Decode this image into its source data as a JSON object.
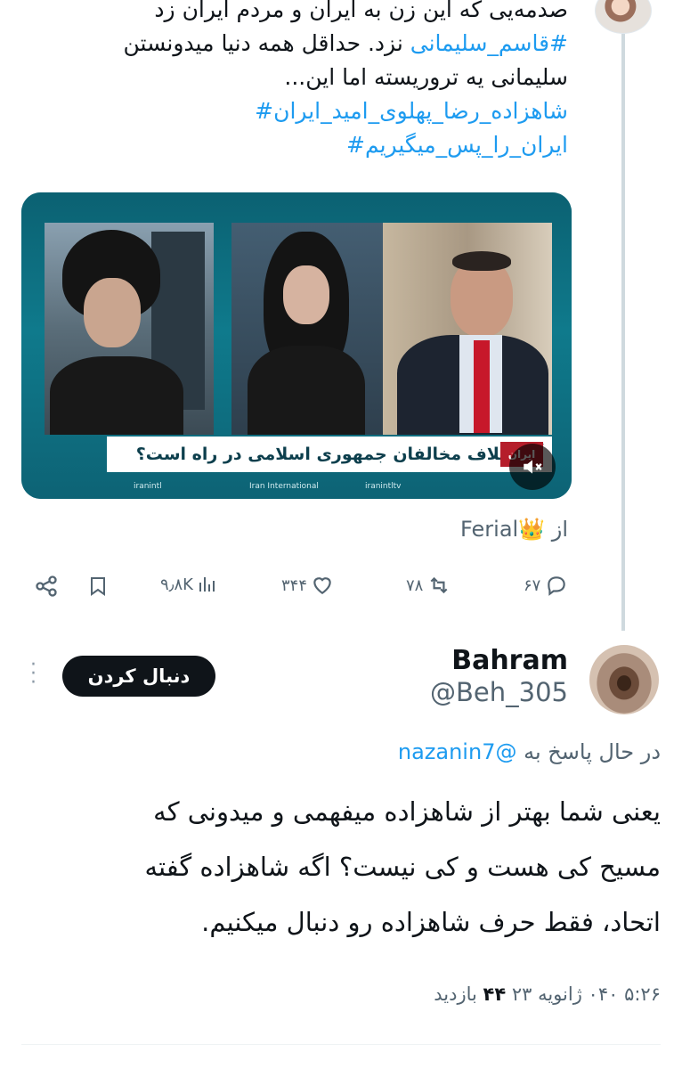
{
  "tweet": {
    "text_line1": "صدمه‌یی که این زن به ایران و مردم ایران زد",
    "text_line2_hashtag": "#قاسم_سلیمانی",
    "text_line2_rest": " نزد. حداقل همه دنیا میدونستن",
    "text_line3": "سلیمانی یه تروریسته اما این...",
    "hashtag1": "شاهزاده_رضا_پهلوی_امید_ایران#",
    "hashtag2": "ایران_را_پس_میگیریم#",
    "video": {
      "banner_text": "آیا ائتلاف مخالفان جمهوری اسلامی در راه است؟",
      "tag": "ایران",
      "footer_left": "iranintl",
      "footer_center": "Iran International",
      "footer_right": "iranintltv",
      "mute_icon": "speaker-muted-icon"
    },
    "from_prefix": "از",
    "from_name": "Ferial",
    "from_emoji": "👑",
    "actions": {
      "replies": "۶۷",
      "retweets": "۷۸",
      "likes": "۳۴۴",
      "views": "۹٫۸K"
    }
  },
  "reply": {
    "name": "Bahram",
    "handle": "@Beh_305",
    "follow_label": "دنبال کردن",
    "replying_prefix": "در حال پاسخ به",
    "replying_to": "@nazanin7",
    "body_line1": "یعنی شما بهتر از شاهزاده میفهمی و میدونی که",
    "body_line2": "مسیح کی هست و کی نیست؟ اگه شاهزاده گفته",
    "body_line3": "اتحاد، فقط حرف شاهزاده رو دنبال میکنیم.",
    "time": "۵:۲۶",
    "date": "۰۴۰ ژانویه ۲۳",
    "views_count": "۴۴",
    "views_label": "بازدید"
  }
}
